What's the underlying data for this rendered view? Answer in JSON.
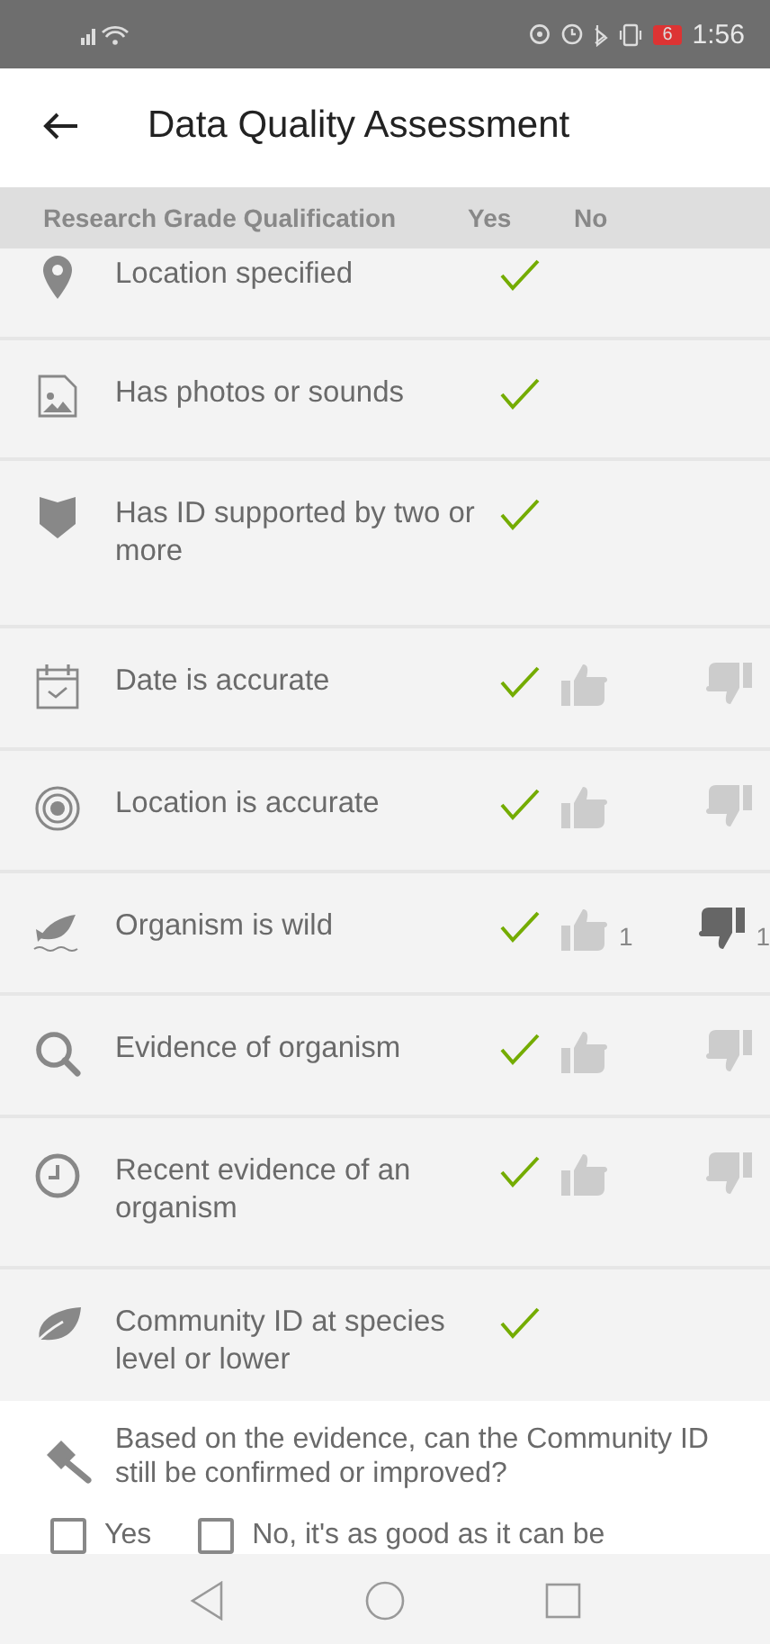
{
  "status_bar": {
    "battery": "6",
    "time": "1:56"
  },
  "app_bar": {
    "title": "Data Quality Assessment"
  },
  "table": {
    "columns": [
      "Research Grade Qualification",
      "Yes",
      "No"
    ],
    "rows": [
      {
        "kind": "pin",
        "label": "Location specified",
        "passed": true,
        "voting": false
      },
      {
        "kind": "image",
        "label": "Has photos or sounds",
        "passed": true,
        "voting": false
      },
      {
        "kind": "shield",
        "label": "Has ID supported by two or more",
        "passed": true,
        "voting": false
      },
      {
        "kind": "calendar",
        "label": "Date is accurate",
        "passed": true,
        "voting": true,
        "disagreed": false
      },
      {
        "kind": "target",
        "label": "Location is accurate",
        "passed": true,
        "voting": true,
        "disagreed": false
      },
      {
        "kind": "fish",
        "label": "Organism is wild",
        "passed": true,
        "voting": true,
        "up_count": "1",
        "down_count": "1",
        "disagreed": true
      },
      {
        "kind": "search",
        "label": "Evidence of organism",
        "passed": true,
        "voting": true,
        "disagreed": false
      },
      {
        "kind": "clock",
        "label": "Recent evidence of an organism",
        "passed": true,
        "voting": true,
        "disagreed": false
      },
      {
        "kind": "leaf",
        "label": "Community ID at species level or lower",
        "passed": true,
        "voting": false
      }
    ]
  },
  "question": {
    "text": "Based on the evidence, can the Community ID still be confirmed or improved?",
    "options": [
      {
        "label": "Yes",
        "checked": false
      },
      {
        "label": "No, it's as good as it can be",
        "checked": false
      }
    ]
  }
}
